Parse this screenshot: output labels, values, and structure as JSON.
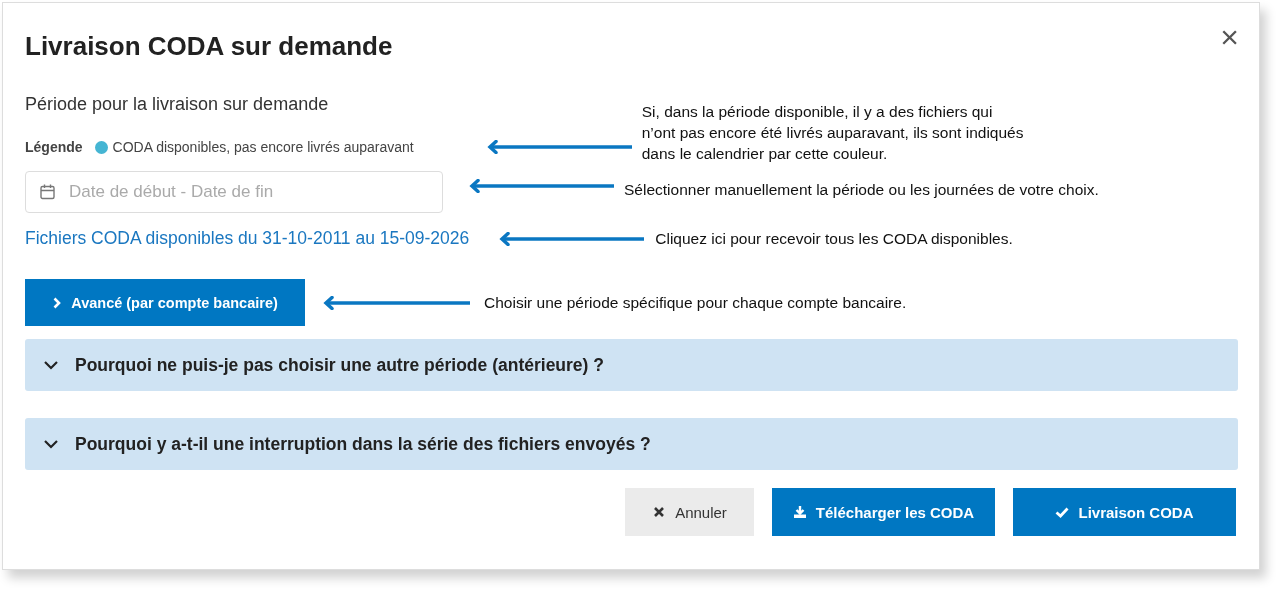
{
  "dialog": {
    "title": "Livraison CODA sur demande",
    "close": "×"
  },
  "section_title": "Période pour la livraison sur demande",
  "legend": {
    "label": "Légende",
    "items": [
      {
        "text": "CODA disponibles, pas encore livrés auparavant",
        "color": "#45b5d3"
      }
    ]
  },
  "date_field": {
    "placeholder": "Date de début - Date de fin"
  },
  "available_link": "Fichiers CODA disponibles du 31-10-2011 au 15-09-2026",
  "advanced_button": {
    "label": "Avancé (par compte bancaire)",
    "expanded": false
  },
  "accordions": [
    {
      "title": "Pourquoi ne puis-je pas choisir une autre période (antérieure) ?",
      "expanded": false
    },
    {
      "title": "Pourquoi y a-t-il une interruption dans la série des fichiers envoyés ?",
      "expanded": false
    }
  ],
  "buttons": [
    {
      "label": "Annuler",
      "kind": "cancel"
    },
    {
      "label": "Télécharger les CODA",
      "kind": "download"
    },
    {
      "label": "Livraison CODA",
      "kind": "deliver"
    }
  ],
  "annotations": [
    {
      "text": "Si, dans la période disponible, il y a des fichiers qui n’ont pas encore été livrés auparavant, ils sont indiqués dans le calendrier par cette couleur."
    },
    {
      "text": "Sélectionner manuellement la période ou les journées de votre choix."
    },
    {
      "text": "Cliquez ici pour recevoir tous les CODA disponibles."
    },
    {
      "text": "Choisir une période spécifique pour chaque compte bancaire."
    }
  ]
}
